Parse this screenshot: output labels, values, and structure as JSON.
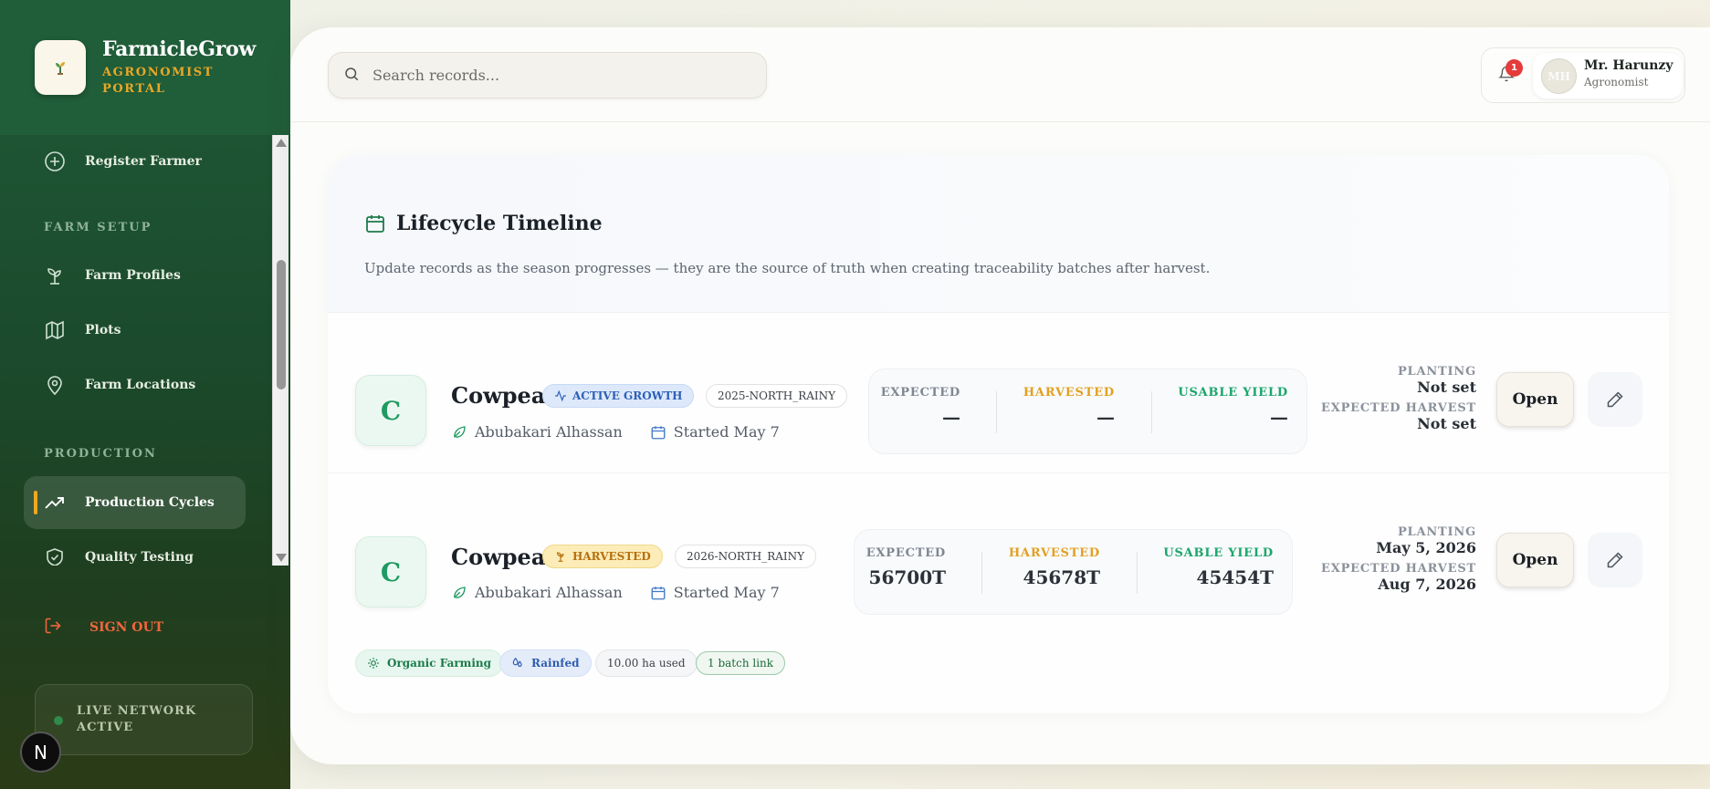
{
  "brand": {
    "name": "FarmicleGrow",
    "subtitle": "AGRONOMIST PORTAL"
  },
  "sidebar": {
    "items": [
      {
        "label": "Register Farmer",
        "icon": "plus-circle-icon"
      },
      {
        "label": "Farm Profiles",
        "icon": "sprout-icon"
      },
      {
        "label": "Plots",
        "icon": "map-icon"
      },
      {
        "label": "Farm Locations",
        "icon": "map-pin-icon"
      },
      {
        "label": "Production Cycles",
        "icon": "trending-up-icon",
        "active": true
      },
      {
        "label": "Quality Testing",
        "icon": "shield-check-icon"
      }
    ],
    "sections": {
      "farm_setup": "FARM SETUP",
      "production": "PRODUCTION"
    },
    "sign_out": "SIGN OUT",
    "network_status": "LIVE NETWORK ACTIVE",
    "framework_badge": "N"
  },
  "header": {
    "search_placeholder": "Search records...",
    "notifications_count": "1",
    "user": {
      "initials": "MH",
      "name": "Mr. Harunzy",
      "role": "Agronomist"
    }
  },
  "timeline": {
    "title": "Lifecycle Timeline",
    "description": "Update records as the season progresses — they are the source of truth when creating traceability batches after harvest.",
    "labels": {
      "expected": "EXPECTED",
      "harvested": "HARVESTED",
      "usable_yield": "USABLE YIELD",
      "planting": "PLANTING",
      "expected_harvest": "EXPECTED HARVEST",
      "open": "Open"
    },
    "cycles": [
      {
        "initial": "C",
        "crop": "Cowpea",
        "status": "ACTIVE GROWTH",
        "season": "2025-NORTH_RAINY",
        "farmer": "Abubakari Alhassan",
        "started": "Started May 7",
        "expected": "—",
        "harvested": "—",
        "usable_yield": "—",
        "planting": "Not set",
        "expected_harvest": "Not set"
      },
      {
        "initial": "C",
        "crop": "Cowpea",
        "status": "HARVESTED",
        "season": "2026-NORTH_RAINY",
        "farmer": "Abubakari Alhassan",
        "started": "Started May 7",
        "expected": "56700T",
        "harvested": "45678T",
        "usable_yield": "45454T",
        "planting": "May 5, 2026",
        "expected_harvest": "Aug 7, 2026",
        "tags": [
          "Organic Farming",
          "Rainfed",
          "10.00 ha used",
          "1 batch link"
        ]
      }
    ]
  },
  "colors": {
    "sidebar_green": "#1f5a37",
    "accent_orange": "#efa81f",
    "signout": "#f0663d",
    "usable_green": "#1da56b",
    "harvested_amber": "#e3a020"
  }
}
